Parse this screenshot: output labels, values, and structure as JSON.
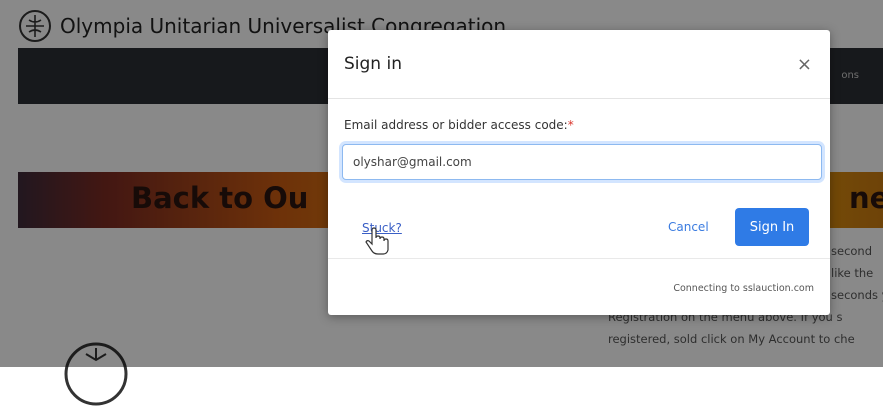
{
  "site": {
    "title": "Olympia Unitarian Universalist Congregation",
    "nav_right_text": "ons"
  },
  "banner": {
    "text_left": "Back to Ou",
    "text_right": "ne"
  },
  "background_text": {
    "lines": [
      "second",
      "like the",
      "seconds y",
      "Registration on the menu above. If you s",
      "registered, sold click on My Account to che"
    ]
  },
  "modal": {
    "title": "Sign in",
    "close_glyph": "×",
    "email_label": "Email address or bidder access code:",
    "required_mark": "*",
    "email_value": "olyshar@gmail.com",
    "stuck_link": "Stuck?",
    "cancel_label": "Cancel",
    "sign_in_label": "Sign In",
    "footer_text": "Connecting to sslauction.com"
  },
  "icons": {
    "site_logo": "chalice-logo-icon",
    "cursor": "hand-pointer-cursor-icon",
    "close": "close-icon"
  }
}
